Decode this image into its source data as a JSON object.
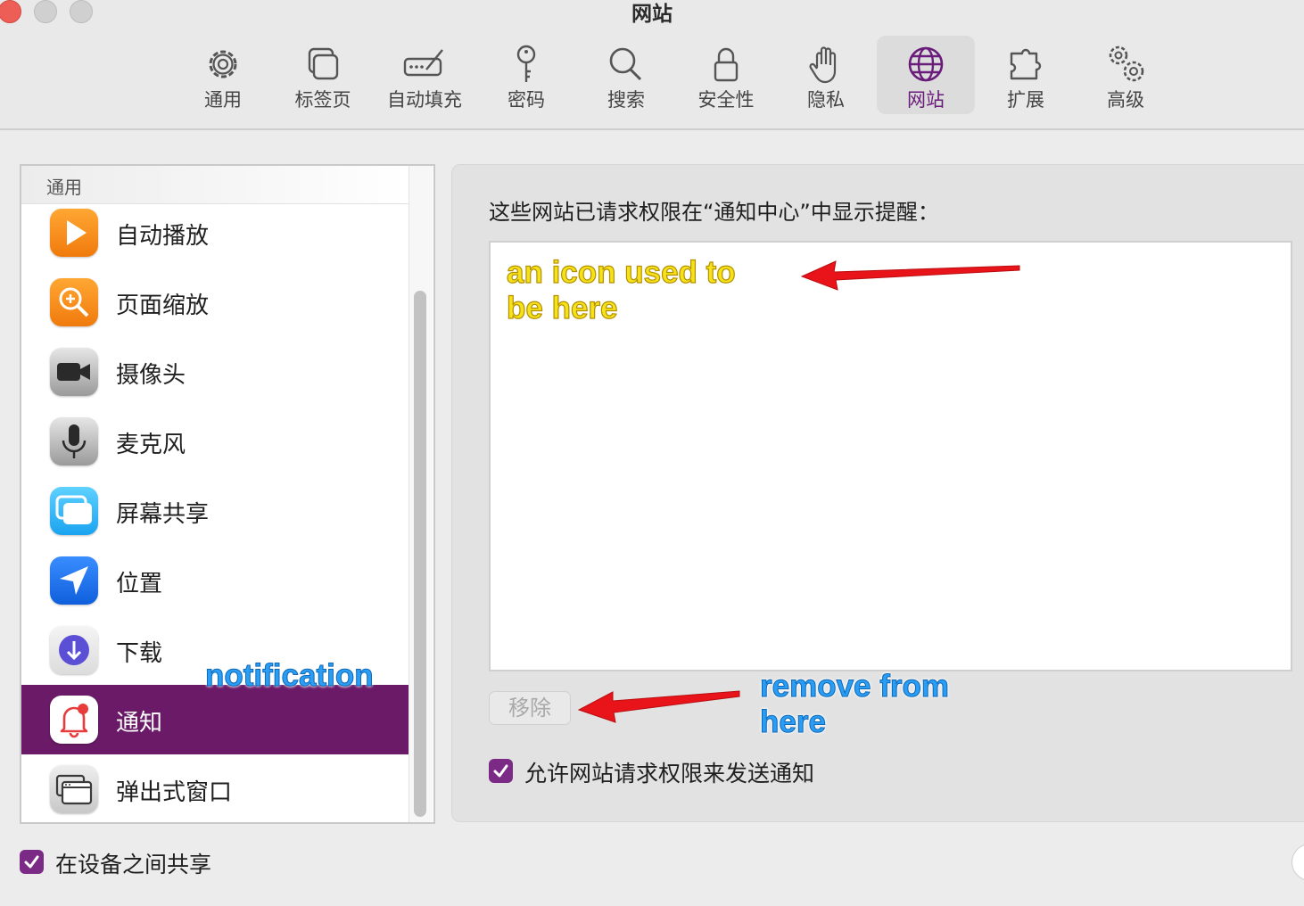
{
  "window": {
    "title": "网站"
  },
  "toolbar": {
    "items": [
      {
        "label": "通用",
        "icon": "gear-icon"
      },
      {
        "label": "标签页",
        "icon": "tabs-icon"
      },
      {
        "label": "自动填充",
        "icon": "autofill-icon"
      },
      {
        "label": "密码",
        "icon": "key-icon"
      },
      {
        "label": "搜索",
        "icon": "magnifier-icon"
      },
      {
        "label": "安全性",
        "icon": "lock-icon"
      },
      {
        "label": "隐私",
        "icon": "hand-icon"
      },
      {
        "label": "网站",
        "icon": "globe-icon",
        "selected": true
      },
      {
        "label": "扩展",
        "icon": "puzzle-icon"
      },
      {
        "label": "高级",
        "icon": "gears-icon"
      }
    ]
  },
  "sidebar": {
    "header": "通用",
    "items": [
      {
        "label": "自动播放",
        "icon": "play-icon"
      },
      {
        "label": "页面缩放",
        "icon": "zoom-icon"
      },
      {
        "label": "摄像头",
        "icon": "camera-icon"
      },
      {
        "label": "麦克风",
        "icon": "microphone-icon"
      },
      {
        "label": "屏幕共享",
        "icon": "screen-share-icon"
      },
      {
        "label": "位置",
        "icon": "location-icon"
      },
      {
        "label": "下载",
        "icon": "download-icon"
      },
      {
        "label": "通知",
        "icon": "bell-icon",
        "selected": true
      },
      {
        "label": "弹出式窗口",
        "icon": "popup-window-icon"
      }
    ]
  },
  "content": {
    "description": "这些网站已请求权限在“通知中心”中显示提醒：",
    "remove_button": "移除",
    "allow_checkbox": {
      "label": "允许网站请求权限来发送通知",
      "checked": true
    }
  },
  "footer": {
    "share_checkbox": {
      "label": "在设备之间共享",
      "checked": true
    }
  },
  "annotations": {
    "icon_note": "an icon used to be here",
    "notification_note": "notification",
    "remove_note": "remove from here"
  },
  "colors": {
    "accent": "#6a1a67",
    "annotation_yellow": "#f5e31a",
    "annotation_blue": "#2a9df4",
    "arrow_red": "#e8141a"
  }
}
